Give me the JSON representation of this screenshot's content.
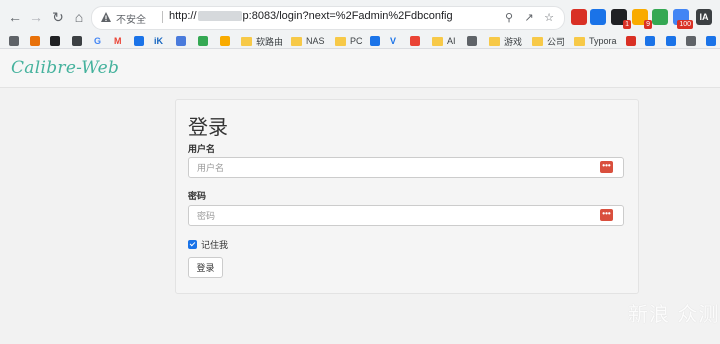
{
  "browser": {
    "omnibox": {
      "security_text": "不安全",
      "url_prefix": "http://",
      "url_suffix": "p:8083/login?next=%2Fadmin%2Fdbconfig"
    },
    "extensions": [
      {
        "name": "ext-1",
        "color": "#d93025",
        "badge": ""
      },
      {
        "name": "ext-2",
        "color": "#1a73e8",
        "badge": ""
      },
      {
        "name": "ext-3",
        "color": "#202124",
        "badge": "1"
      },
      {
        "name": "ext-4",
        "color": "#f9ab00",
        "badge": "9"
      },
      {
        "name": "ext-5",
        "color": "#34a853",
        "badge": ""
      },
      {
        "name": "ext-6",
        "color": "#4285f4",
        "badge": "100"
      },
      {
        "name": "ext-7",
        "color": "#3c4043",
        "badge": ""
      }
    ],
    "ext_ia_label": "IA"
  },
  "bookmarks": [
    {
      "label": "",
      "type": "icon",
      "color": "#5f6368"
    },
    {
      "label": "",
      "type": "icon",
      "color": "#e8710a"
    },
    {
      "label": "",
      "type": "icon",
      "color": "#202124"
    },
    {
      "label": "",
      "type": "icon",
      "color": "#3c4043"
    },
    {
      "label": "G",
      "type": "icon",
      "color": "#4285f4"
    },
    {
      "label": "M",
      "type": "icon",
      "color": "#ea4335"
    },
    {
      "label": "",
      "type": "icon",
      "color": "#1a73e8"
    },
    {
      "label": "iK",
      "type": "icon",
      "color": "#1565c0"
    },
    {
      "label": "",
      "type": "icon",
      "color": "#4a7bdc"
    },
    {
      "label": "",
      "type": "icon",
      "color": "#34a853"
    },
    {
      "label": "",
      "type": "icon",
      "color": "#f9ab00"
    },
    {
      "label": "软路由",
      "type": "folder"
    },
    {
      "label": "NAS",
      "type": "folder"
    },
    {
      "label": "PC",
      "type": "folder"
    },
    {
      "label": "",
      "type": "icon",
      "color": "#1a73e8"
    },
    {
      "label": "V",
      "type": "icon",
      "color": "#1a73e8"
    },
    {
      "label": "",
      "type": "icon",
      "color": "#ea4335"
    },
    {
      "label": "AI",
      "type": "folder"
    },
    {
      "label": "",
      "type": "icon",
      "color": "#5f6368"
    },
    {
      "label": "游戏",
      "type": "folder"
    },
    {
      "label": "公司",
      "type": "folder"
    },
    {
      "label": "Typora",
      "type": "folder"
    },
    {
      "label": "",
      "type": "icon",
      "color": "#d93025"
    },
    {
      "label": "",
      "type": "icon",
      "color": "#1a73e8"
    },
    {
      "label": "",
      "type": "icon",
      "color": "#1a73e8"
    },
    {
      "label": "",
      "type": "icon",
      "color": "#5f6368"
    },
    {
      "label": "",
      "type": "icon",
      "color": "#1a73e8"
    }
  ],
  "app": {
    "brand": "Calibre-Web",
    "login": {
      "title": "登录",
      "username_label": "用户名",
      "username_placeholder": "用户名",
      "password_label": "密码",
      "password_placeholder": "密码",
      "remember_label": "记住我",
      "remember_checked": true,
      "submit_label": "登录",
      "password_manager_glyph": "•••"
    }
  },
  "watermark": "新浪 众测",
  "colors": {
    "brand": "#45b29d",
    "password_manager": "#d94f3d",
    "checkbox": "#1a73e8"
  }
}
